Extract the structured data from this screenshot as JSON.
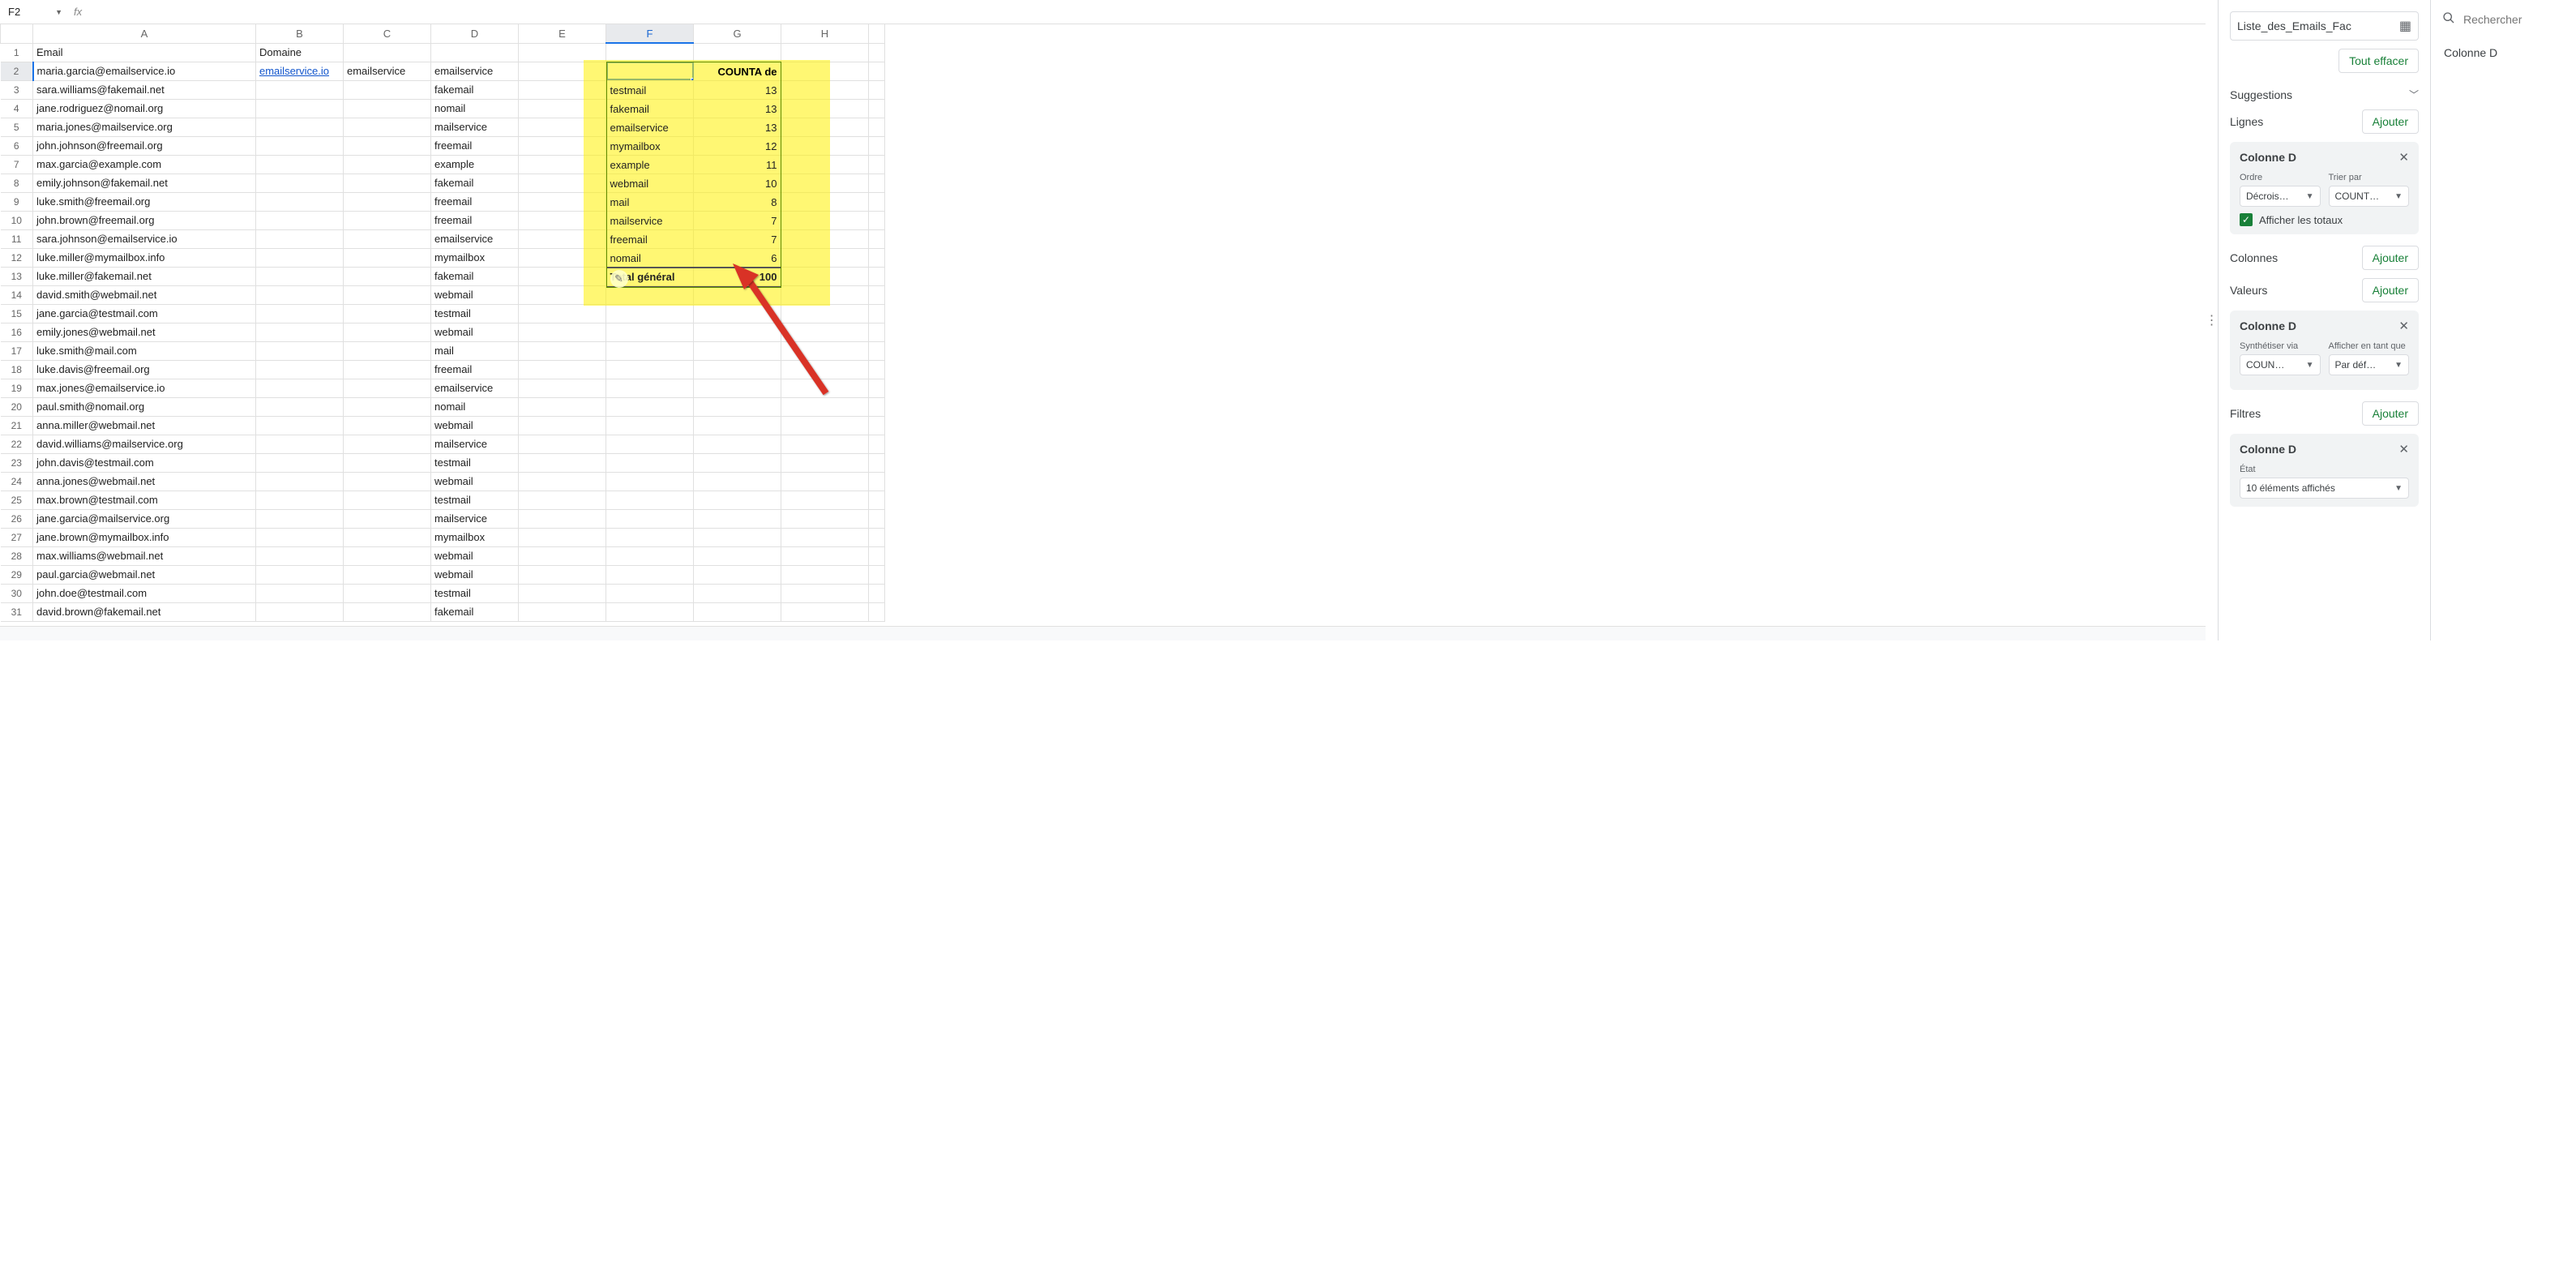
{
  "namebox": "F2",
  "columns": [
    "A",
    "B",
    "C",
    "D",
    "E",
    "F",
    "G",
    "H",
    ""
  ],
  "headers": {
    "A": "Email",
    "B": "Domaine"
  },
  "rows": [
    {
      "n": 1,
      "A": "Email",
      "B": "Domaine"
    },
    {
      "n": 2,
      "A": "maria.garcia@emailservice.io",
      "B": "emailservice.io",
      "B_link": true,
      "C": "emailservice",
      "D": "emailservice"
    },
    {
      "n": 3,
      "A": "sara.williams@fakemail.net",
      "D": "fakemail"
    },
    {
      "n": 4,
      "A": "jane.rodriguez@nomail.org",
      "D": "nomail"
    },
    {
      "n": 5,
      "A": "maria.jones@mailservice.org",
      "D": "mailservice"
    },
    {
      "n": 6,
      "A": "john.johnson@freemail.org",
      "D": "freemail"
    },
    {
      "n": 7,
      "A": "max.garcia@example.com",
      "D": "example"
    },
    {
      "n": 8,
      "A": "emily.johnson@fakemail.net",
      "D": "fakemail"
    },
    {
      "n": 9,
      "A": "luke.smith@freemail.org",
      "D": "freemail"
    },
    {
      "n": 10,
      "A": "john.brown@freemail.org",
      "D": "freemail"
    },
    {
      "n": 11,
      "A": "sara.johnson@emailservice.io",
      "D": "emailservice"
    },
    {
      "n": 12,
      "A": "luke.miller@mymailbox.info",
      "D": "mymailbox"
    },
    {
      "n": 13,
      "A": "luke.miller@fakemail.net",
      "D": "fakemail"
    },
    {
      "n": 14,
      "A": "david.smith@webmail.net",
      "D": "webmail"
    },
    {
      "n": 15,
      "A": "jane.garcia@testmail.com",
      "D": "testmail"
    },
    {
      "n": 16,
      "A": "emily.jones@webmail.net",
      "D": "webmail"
    },
    {
      "n": 17,
      "A": "luke.smith@mail.com",
      "D": "mail"
    },
    {
      "n": 18,
      "A": "luke.davis@freemail.org",
      "D": "freemail"
    },
    {
      "n": 19,
      "A": "max.jones@emailservice.io",
      "D": "emailservice"
    },
    {
      "n": 20,
      "A": "paul.smith@nomail.org",
      "D": "nomail"
    },
    {
      "n": 21,
      "A": "anna.miller@webmail.net",
      "D": "webmail"
    },
    {
      "n": 22,
      "A": "david.williams@mailservice.org",
      "D": "mailservice"
    },
    {
      "n": 23,
      "A": "john.davis@testmail.com",
      "D": "testmail"
    },
    {
      "n": 24,
      "A": "anna.jones@webmail.net",
      "D": "webmail"
    },
    {
      "n": 25,
      "A": "max.brown@testmail.com",
      "D": "testmail"
    },
    {
      "n": 26,
      "A": "jane.garcia@mailservice.org",
      "D": "mailservice"
    },
    {
      "n": 27,
      "A": "jane.brown@mymailbox.info",
      "D": "mymailbox"
    },
    {
      "n": 28,
      "A": "max.williams@webmail.net",
      "D": "webmail"
    },
    {
      "n": 29,
      "A": "paul.garcia@webmail.net",
      "D": "webmail"
    },
    {
      "n": 30,
      "A": "john.doe@testmail.com",
      "D": "testmail"
    },
    {
      "n": 31,
      "A": "david.brown@fakemail.net",
      "D": "fakemail"
    }
  ],
  "pivot": {
    "header_right": "COUNTA de",
    "rows": [
      {
        "label": "testmail",
        "val": "13"
      },
      {
        "label": "fakemail",
        "val": "13"
      },
      {
        "label": "emailservice",
        "val": "13"
      },
      {
        "label": "mymailbox",
        "val": "12"
      },
      {
        "label": "example",
        "val": "11"
      },
      {
        "label": "webmail",
        "val": "10"
      },
      {
        "label": "mail",
        "val": "8"
      },
      {
        "label": "mailservice",
        "val": "7"
      },
      {
        "label": "freemail",
        "val": "7"
      },
      {
        "label": "nomail",
        "val": "6"
      }
    ],
    "total_label": "Total général",
    "total_val": "100"
  },
  "panel": {
    "range": "Liste_des_Emails_Fac",
    "clear": "Tout effacer",
    "suggestions": "Suggestions",
    "lines": "Lignes",
    "columns": "Colonnes",
    "values": "Valeurs",
    "filters": "Filtres",
    "add": "Ajouter",
    "chip_title": "Colonne D",
    "order_lbl": "Ordre",
    "order_val": "Décrois…",
    "sortby_lbl": "Trier par",
    "sortby_val": "COUNT…",
    "show_totals": "Afficher les totaux",
    "synth_lbl": "Synthétiser via",
    "synth_val": "COUN…",
    "showas_lbl": "Afficher en tant que",
    "showas_val": "Par déf…",
    "state_lbl": "État",
    "state_val": "10 éléments affichés"
  },
  "right": {
    "search_placeholder": "Rechercher",
    "item": "Colonne D"
  }
}
